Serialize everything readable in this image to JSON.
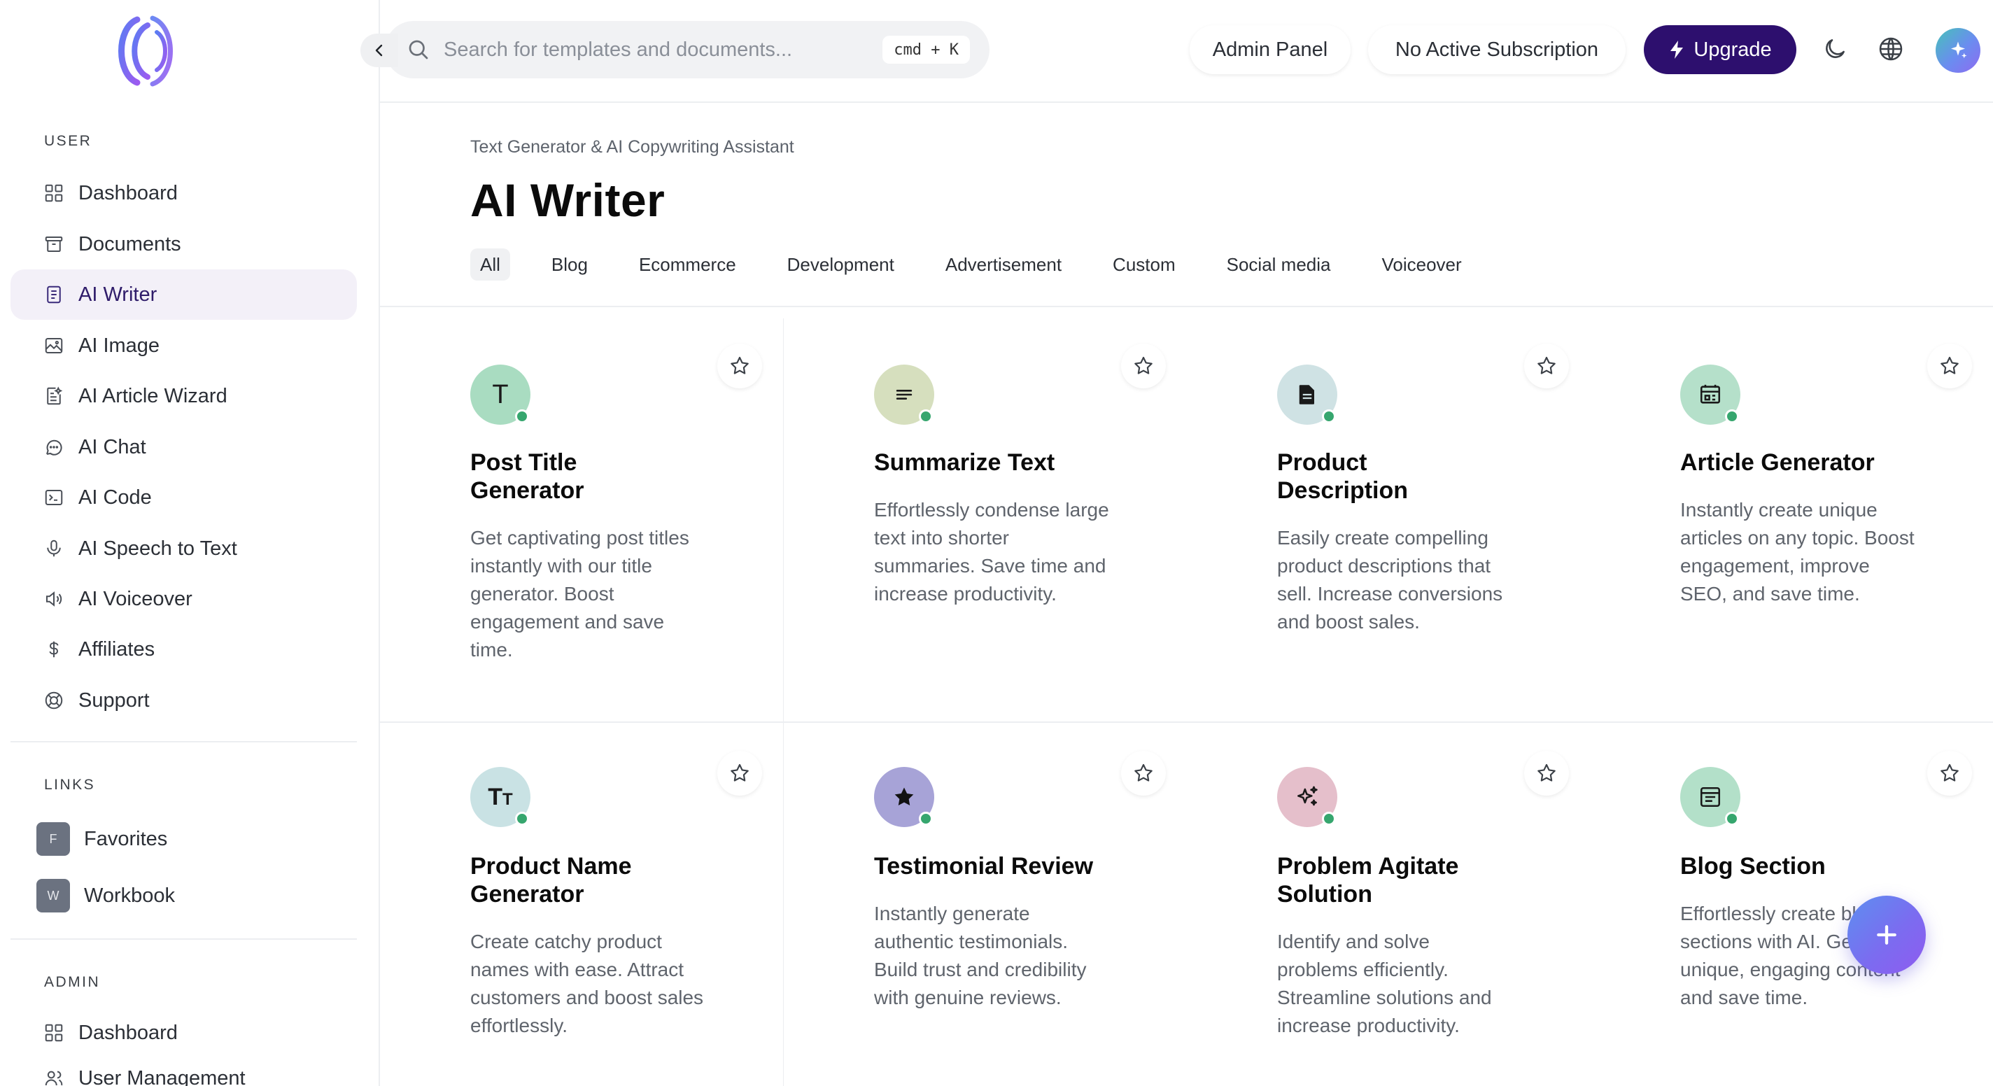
{
  "sidebar": {
    "sections": {
      "user": "USER",
      "links": "LINKS",
      "admin": "ADMIN"
    },
    "user_items": [
      {
        "label": "Dashboard",
        "icon": "dashboard-icon"
      },
      {
        "label": "Documents",
        "icon": "archive-icon"
      },
      {
        "label": "AI Writer",
        "icon": "document-icon",
        "active": true
      },
      {
        "label": "AI Image",
        "icon": "image-icon"
      },
      {
        "label": "AI Article Wizard",
        "icon": "article-wizard-icon"
      },
      {
        "label": "AI Chat",
        "icon": "chat-icon"
      },
      {
        "label": "AI Code",
        "icon": "terminal-icon"
      },
      {
        "label": "AI Speech to Text",
        "icon": "microphone-icon"
      },
      {
        "label": "AI Voiceover",
        "icon": "speaker-icon"
      },
      {
        "label": "Affiliates",
        "icon": "dollar-icon"
      },
      {
        "label": "Support",
        "icon": "lifebuoy-icon"
      }
    ],
    "link_items": [
      {
        "initial": "F",
        "label": "Favorites"
      },
      {
        "initial": "W",
        "label": "Workbook"
      }
    ],
    "admin_items": [
      {
        "label": "Dashboard",
        "icon": "dashboard-icon"
      },
      {
        "label": "User Management",
        "icon": "users-icon"
      }
    ]
  },
  "topbar": {
    "search_placeholder": "Search for templates and documents...",
    "shortcut": "cmd + K",
    "admin_panel": "Admin Panel",
    "subscription": "No Active Subscription",
    "upgrade": "Upgrade"
  },
  "header": {
    "breadcrumb": "Text Generator & AI Copywriting Assistant",
    "title": "AI Writer",
    "tabs": [
      "All",
      "Blog",
      "Ecommerce",
      "Development",
      "Advertisement",
      "Custom",
      "Social media",
      "Voiceover"
    ]
  },
  "cards": [
    {
      "title": "Post Title Generator",
      "desc": "Get captivating post titles instantly with our title generator. Boost engagement and save time.",
      "icon": "letter-t-icon",
      "bg": "#a9dcc1"
    },
    {
      "title": "Summarize Text",
      "desc": "Effortlessly condense large text into shorter summaries. Save time and increase productivity.",
      "icon": "text-lines-icon",
      "bg": "#d6dfbe"
    },
    {
      "title": "Product Description",
      "desc": "Easily create compelling product descriptions that sell. Increase conversions and boost sales.",
      "icon": "file-icon",
      "bg": "#cfe2e4"
    },
    {
      "title": "Article Generator",
      "desc": "Instantly create unique articles on any topic. Boost engagement, improve SEO, and save time.",
      "icon": "article-icon",
      "bg": "#b5e0ca"
    },
    {
      "title": "Product Name Generator",
      "desc": "Create catchy product names with ease. Attract customers and boost sales effortlessly.",
      "icon": "font-size-icon",
      "bg": "#c9e2e4"
    },
    {
      "title": "Testimonial Review",
      "desc": "Instantly generate authentic testimonials. Build trust and credibility with genuine reviews.",
      "icon": "star-icon",
      "bg": "#a7a3d7"
    },
    {
      "title": "Problem Agitate Solution",
      "desc": "Identify and solve problems efficiently. Streamline solutions and increase productivity.",
      "icon": "sparkles-icon",
      "bg": "#e5bfcb"
    },
    {
      "title": "Blog Section",
      "desc": "Effortlessly create blog sections with AI. Get unique, engaging content and save time.",
      "icon": "blog-icon",
      "bg": "#b3e0c9"
    }
  ]
}
